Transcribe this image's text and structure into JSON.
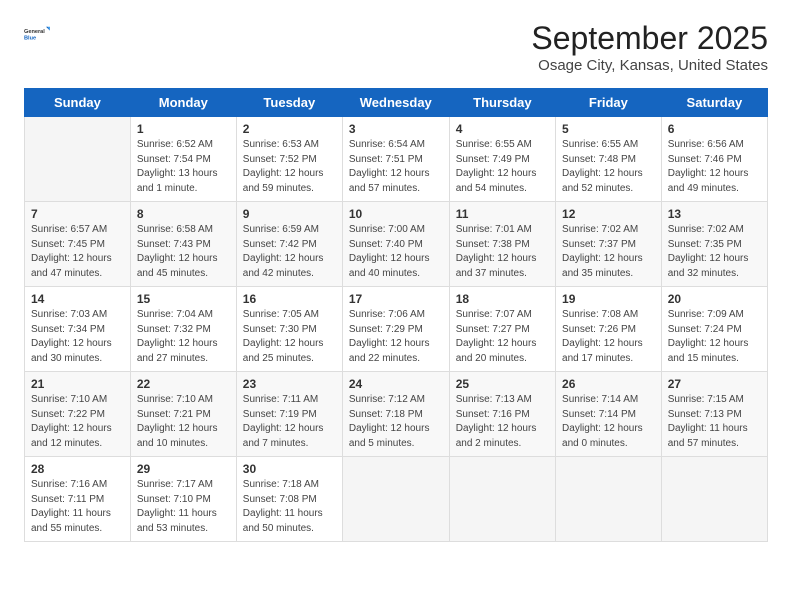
{
  "header": {
    "logo_line1": "General",
    "logo_line2": "Blue",
    "title": "September 2025",
    "subtitle": "Osage City, Kansas, United States"
  },
  "weekdays": [
    "Sunday",
    "Monday",
    "Tuesday",
    "Wednesday",
    "Thursday",
    "Friday",
    "Saturday"
  ],
  "weeks": [
    [
      {
        "day": "",
        "info": ""
      },
      {
        "day": "1",
        "info": "Sunrise: 6:52 AM\nSunset: 7:54 PM\nDaylight: 13 hours\nand 1 minute."
      },
      {
        "day": "2",
        "info": "Sunrise: 6:53 AM\nSunset: 7:52 PM\nDaylight: 12 hours\nand 59 minutes."
      },
      {
        "day": "3",
        "info": "Sunrise: 6:54 AM\nSunset: 7:51 PM\nDaylight: 12 hours\nand 57 minutes."
      },
      {
        "day": "4",
        "info": "Sunrise: 6:55 AM\nSunset: 7:49 PM\nDaylight: 12 hours\nand 54 minutes."
      },
      {
        "day": "5",
        "info": "Sunrise: 6:55 AM\nSunset: 7:48 PM\nDaylight: 12 hours\nand 52 minutes."
      },
      {
        "day": "6",
        "info": "Sunrise: 6:56 AM\nSunset: 7:46 PM\nDaylight: 12 hours\nand 49 minutes."
      }
    ],
    [
      {
        "day": "7",
        "info": "Sunrise: 6:57 AM\nSunset: 7:45 PM\nDaylight: 12 hours\nand 47 minutes."
      },
      {
        "day": "8",
        "info": "Sunrise: 6:58 AM\nSunset: 7:43 PM\nDaylight: 12 hours\nand 45 minutes."
      },
      {
        "day": "9",
        "info": "Sunrise: 6:59 AM\nSunset: 7:42 PM\nDaylight: 12 hours\nand 42 minutes."
      },
      {
        "day": "10",
        "info": "Sunrise: 7:00 AM\nSunset: 7:40 PM\nDaylight: 12 hours\nand 40 minutes."
      },
      {
        "day": "11",
        "info": "Sunrise: 7:01 AM\nSunset: 7:38 PM\nDaylight: 12 hours\nand 37 minutes."
      },
      {
        "day": "12",
        "info": "Sunrise: 7:02 AM\nSunset: 7:37 PM\nDaylight: 12 hours\nand 35 minutes."
      },
      {
        "day": "13",
        "info": "Sunrise: 7:02 AM\nSunset: 7:35 PM\nDaylight: 12 hours\nand 32 minutes."
      }
    ],
    [
      {
        "day": "14",
        "info": "Sunrise: 7:03 AM\nSunset: 7:34 PM\nDaylight: 12 hours\nand 30 minutes."
      },
      {
        "day": "15",
        "info": "Sunrise: 7:04 AM\nSunset: 7:32 PM\nDaylight: 12 hours\nand 27 minutes."
      },
      {
        "day": "16",
        "info": "Sunrise: 7:05 AM\nSunset: 7:30 PM\nDaylight: 12 hours\nand 25 minutes."
      },
      {
        "day": "17",
        "info": "Sunrise: 7:06 AM\nSunset: 7:29 PM\nDaylight: 12 hours\nand 22 minutes."
      },
      {
        "day": "18",
        "info": "Sunrise: 7:07 AM\nSunset: 7:27 PM\nDaylight: 12 hours\nand 20 minutes."
      },
      {
        "day": "19",
        "info": "Sunrise: 7:08 AM\nSunset: 7:26 PM\nDaylight: 12 hours\nand 17 minutes."
      },
      {
        "day": "20",
        "info": "Sunrise: 7:09 AM\nSunset: 7:24 PM\nDaylight: 12 hours\nand 15 minutes."
      }
    ],
    [
      {
        "day": "21",
        "info": "Sunrise: 7:10 AM\nSunset: 7:22 PM\nDaylight: 12 hours\nand 12 minutes."
      },
      {
        "day": "22",
        "info": "Sunrise: 7:10 AM\nSunset: 7:21 PM\nDaylight: 12 hours\nand 10 minutes."
      },
      {
        "day": "23",
        "info": "Sunrise: 7:11 AM\nSunset: 7:19 PM\nDaylight: 12 hours\nand 7 minutes."
      },
      {
        "day": "24",
        "info": "Sunrise: 7:12 AM\nSunset: 7:18 PM\nDaylight: 12 hours\nand 5 minutes."
      },
      {
        "day": "25",
        "info": "Sunrise: 7:13 AM\nSunset: 7:16 PM\nDaylight: 12 hours\nand 2 minutes."
      },
      {
        "day": "26",
        "info": "Sunrise: 7:14 AM\nSunset: 7:14 PM\nDaylight: 12 hours\nand 0 minutes."
      },
      {
        "day": "27",
        "info": "Sunrise: 7:15 AM\nSunset: 7:13 PM\nDaylight: 11 hours\nand 57 minutes."
      }
    ],
    [
      {
        "day": "28",
        "info": "Sunrise: 7:16 AM\nSunset: 7:11 PM\nDaylight: 11 hours\nand 55 minutes."
      },
      {
        "day": "29",
        "info": "Sunrise: 7:17 AM\nSunset: 7:10 PM\nDaylight: 11 hours\nand 53 minutes."
      },
      {
        "day": "30",
        "info": "Sunrise: 7:18 AM\nSunset: 7:08 PM\nDaylight: 11 hours\nand 50 minutes."
      },
      {
        "day": "",
        "info": ""
      },
      {
        "day": "",
        "info": ""
      },
      {
        "day": "",
        "info": ""
      },
      {
        "day": "",
        "info": ""
      }
    ]
  ]
}
